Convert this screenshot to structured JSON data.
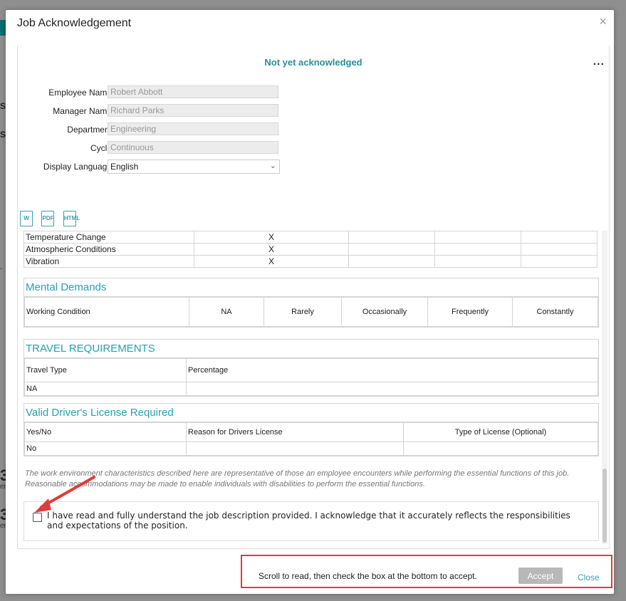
{
  "background": {
    "frag1": "Ser",
    "frag2": "Ser",
    "dash": "- ",
    "big1": "3",
    "small1": "enc",
    "big2": "3",
    "small2": "enc"
  },
  "modal": {
    "title": "Job Acknowledgement",
    "close_symbol": "×",
    "status": "Not yet acknowledged",
    "more_symbol": "...",
    "accent_color": "#2a9fb0"
  },
  "form": {
    "employee_name_label": "Employee Name",
    "employee_name_value": "Robert Abbott",
    "manager_name_label": "Manager Name",
    "manager_name_value": "Richard Parks",
    "department_label": "Department",
    "department_value": "Engineering",
    "cycle_label": "Cycle",
    "cycle_value": "Continuous",
    "display_language_label": "Display Language",
    "display_language_value": "English"
  },
  "export_icons": [
    "word-icon",
    "pdf-icon",
    "html-icon"
  ],
  "export_icon_labels": [
    "W",
    "PDF",
    "HTML"
  ],
  "physical_rows": [
    {
      "label": "Temperature Change",
      "mark": "X"
    },
    {
      "label": "Atmospheric Conditions",
      "mark": "X"
    },
    {
      "label": "Vibration",
      "mark": "X"
    }
  ],
  "mental": {
    "title": "Mental Demands",
    "headers": [
      "Working Condition",
      "NA",
      "Rarely",
      "Occasionally",
      "Frequently",
      "Constantly"
    ]
  },
  "travel": {
    "title": "TRAVEL REQUIREMENTS",
    "headers": [
      "Travel Type",
      "Percentage"
    ],
    "row": [
      "NA",
      ""
    ]
  },
  "license": {
    "title": "Valid Driver's License Required",
    "headers": [
      "Yes/No",
      "Reason for Drivers License",
      "Type of License (Optional)"
    ],
    "row": [
      "No",
      "",
      ""
    ]
  },
  "disclaimer": "The work environment characteristics described here are representative of those an employee encounters while performing the essential functions of this job. Reasonable accommodations may be made to enable individuals with disabilities to perform the essential functions.",
  "acknowledge_text": "I have read and fully understand the job description provided. I acknowledge that it accurately reflects the responsibilities and expectations of the position.",
  "footer": {
    "instruction": "Scroll to read, then check the box at the bottom to accept.",
    "accept_label": "Accept",
    "close_label": "Close"
  }
}
